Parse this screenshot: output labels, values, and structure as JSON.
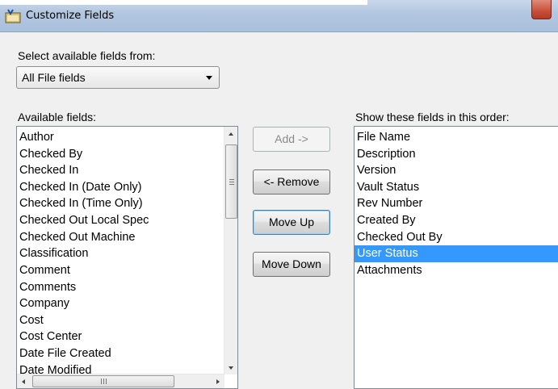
{
  "window": {
    "title": "Customize Fields"
  },
  "source": {
    "label": "Select available fields from:",
    "selected": "All File fields"
  },
  "available": {
    "label": "Available fields:",
    "items": [
      "Author",
      "Checked By",
      "Checked In",
      "Checked In (Date Only)",
      "Checked In (Time Only)",
      "Checked Out Local Spec",
      "Checked Out Machine",
      "Classification",
      "Comment",
      "Comments",
      "Company",
      "Cost",
      "Cost Center",
      "Date File Created",
      "Date Modified"
    ]
  },
  "buttons": {
    "add": "Add ->",
    "remove": "<- Remove",
    "move_up": "Move Up",
    "move_down": "Move Down"
  },
  "shown": {
    "label": "Show these fields in this order:",
    "items": [
      "File Name",
      "Description",
      "Version",
      "Vault Status",
      "Rev Number",
      "Created By",
      "Checked Out By",
      "User Status",
      "Attachments"
    ],
    "selected": "User Status"
  },
  "colors": {
    "selection": "#3399ff",
    "close_button": "#c8503a"
  }
}
